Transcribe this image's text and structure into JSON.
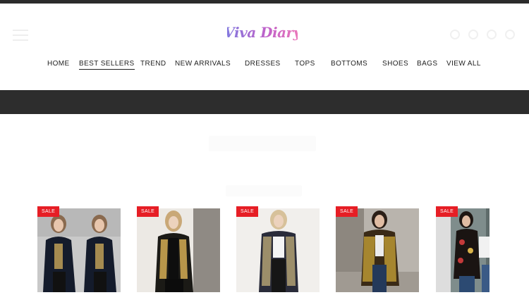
{
  "brand": {
    "logo_text": "Viva Diary",
    "logo_colors": [
      "#7f7be0",
      "#c061c9",
      "#f07bb8"
    ]
  },
  "header": {
    "icons": [
      "menu-icon",
      "search-icon",
      "account-icon",
      "wishlist-icon",
      "cart-icon"
    ]
  },
  "nav": {
    "items": [
      {
        "label": "HOME"
      },
      {
        "label": "BEST SELLERS",
        "active": true
      },
      {
        "label": "TREND"
      },
      {
        "label": "NEW ARRIVALS"
      },
      {
        "label": "DRESSES"
      },
      {
        "label": "TOPS"
      },
      {
        "label": "BOTTOMS"
      },
      {
        "label": "SHOES"
      },
      {
        "label": "BAGS"
      },
      {
        "label": "VIEW ALL"
      }
    ]
  },
  "products": [
    {
      "badge": "SALE"
    },
    {
      "badge": "SALE"
    },
    {
      "badge": "SALE"
    },
    {
      "badge": "SALE"
    },
    {
      "badge": "SALE"
    }
  ],
  "colors": {
    "sale_badge": "#e61e25",
    "dark_band": "#2d2d2d"
  }
}
